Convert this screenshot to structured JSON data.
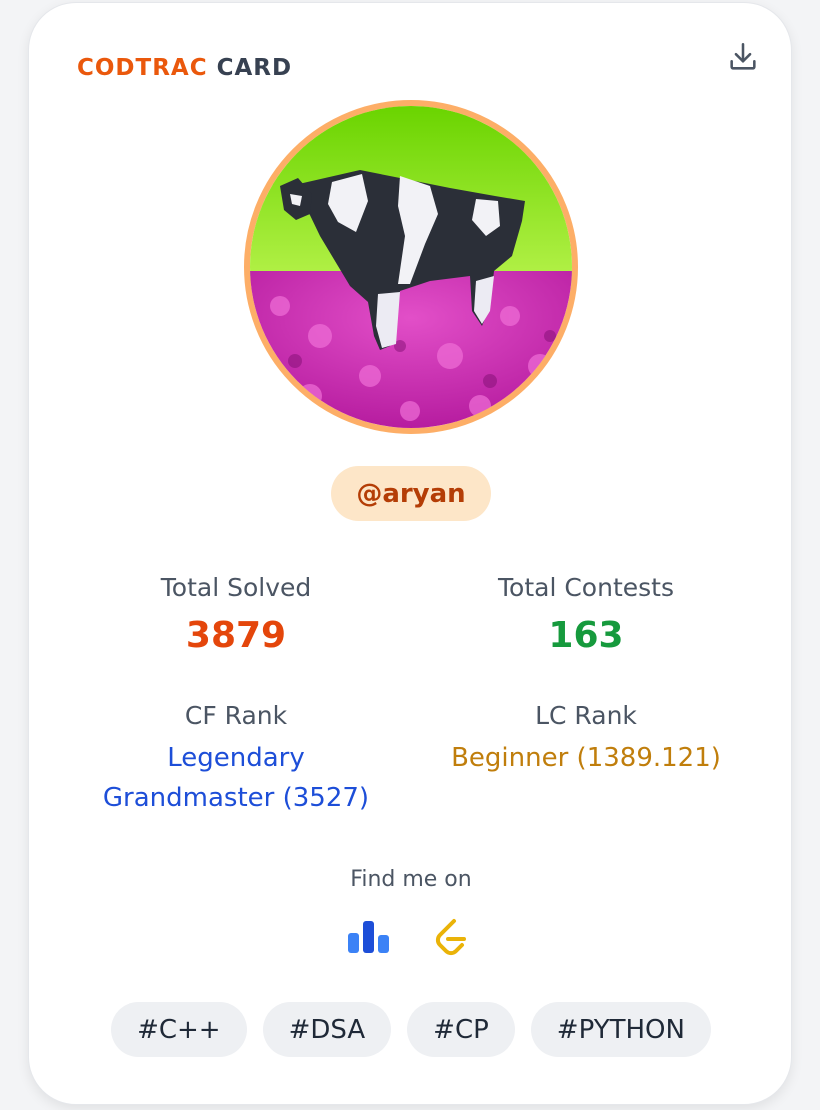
{
  "brand": {
    "part1": "CODTRAC",
    "part2": "CARD"
  },
  "header": {
    "download_icon": "download-icon"
  },
  "profile": {
    "avatar": "cow-in-flower-field",
    "handle": "@aryan"
  },
  "stats": {
    "solved_label": "Total Solved",
    "solved_value": "3879",
    "contests_label": "Total Contests",
    "contests_value": "163"
  },
  "ranks": {
    "cf_label": "CF Rank",
    "cf_line1": "Legendary",
    "cf_line2": "Grandmaster (3527)",
    "lc_label": "LC Rank",
    "lc_value": "Beginner (1389.121)"
  },
  "social": {
    "heading": "Find me on",
    "icons": [
      "codeforces-icon",
      "leetcode-icon"
    ]
  },
  "tags": [
    "#C++",
    "#DSA",
    "#CP",
    "#PYTHON"
  ],
  "colors": {
    "accent_orange": "#ea580c",
    "solved": "#e4460b",
    "contests": "#169a3d",
    "cf_rank": "#1d4ed8",
    "lc_rank": "#c07e0c",
    "avatar_ring": "#fdae67"
  }
}
